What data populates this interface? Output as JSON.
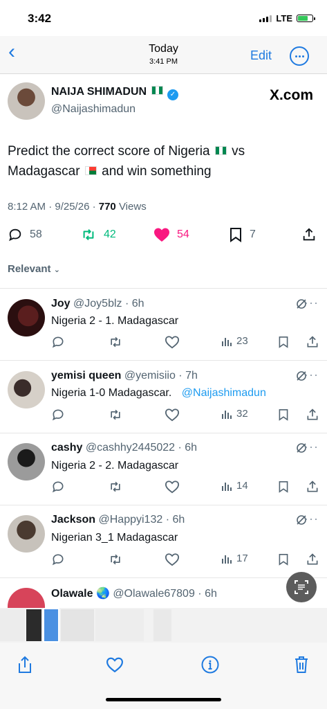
{
  "status": {
    "time": "3:42",
    "network": "LTE"
  },
  "nav": {
    "title": "Today",
    "subtitle": "3:41 PM",
    "edit": "Edit"
  },
  "tweet": {
    "author": "NAIJA SHIMADUN",
    "handle": "@Naijashimadun",
    "site": "X.com",
    "text_a": "Predict the correct score of Nigeria",
    "text_b": "vs",
    "text_c": "Madagascar",
    "text_d": "and win something",
    "time": "8:12 AM · 9/25/26 ·",
    "views_count": "770",
    "views_label": "Views",
    "replies": "58",
    "reposts": "42",
    "likes": "54",
    "bookmarks": "7"
  },
  "sort": {
    "label": "Relevant"
  },
  "replies": [
    {
      "name": "Joy",
      "handle": "@Joy5blz · 6h",
      "text": "Nigeria  2 - 1. Madagascar",
      "views": "23"
    },
    {
      "name": "yemisi queen",
      "handle": "@yemisiio · 7h",
      "text": "Nigeria 1-0 Madagascar.",
      "mention": "@Naijashimadun",
      "views": "32"
    },
    {
      "name": "cashy",
      "handle": "@cashhy2445022 · 6h",
      "text": "Nigeria  2 -  2.  Madagascar",
      "views": "14"
    },
    {
      "name": "Jackson",
      "handle": "@Happyi132 · 6h",
      "text": "Nigerian 3_1 Madagascar",
      "views": "17"
    },
    {
      "name": "Olawale",
      "handle": "@Olawale67809 · 6h"
    }
  ],
  "colors": {
    "accent": "#1f7ae0",
    "x_blue": "#1d9bf0",
    "repost": "#00ba7c",
    "like": "#f91880",
    "muted": "#536471"
  },
  "icons": [
    "back-icon",
    "more-icon",
    "verified-icon",
    "reply-icon",
    "repost-icon",
    "heart-icon",
    "bookmark-icon",
    "share-icon",
    "views-icon",
    "mute-icon",
    "share-toolbar-icon",
    "favorite-icon",
    "info-icon",
    "trash-icon"
  ]
}
